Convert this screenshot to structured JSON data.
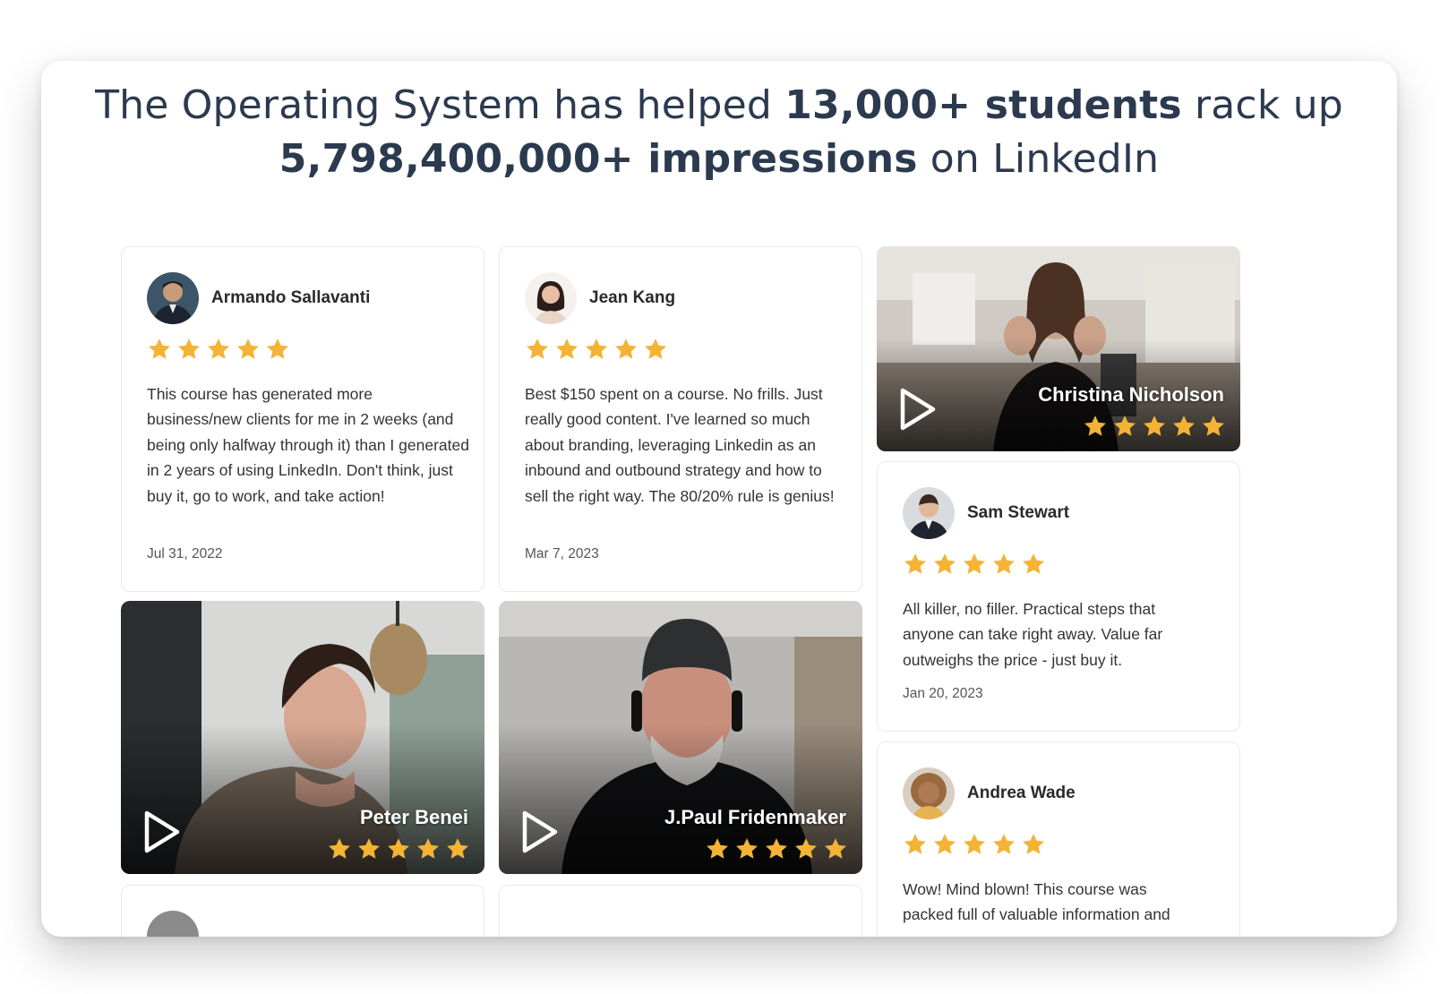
{
  "headline": {
    "line1_a": "The Operating System has helped ",
    "line1_b": "13,000+ students",
    "line1_c": " rack up",
    "line2_a": "5,798,400,000+ impressions",
    "line2_b": " on LinkedIn"
  },
  "reviews": [
    {
      "name": "Armando Sallavanti",
      "rating": 5,
      "text": "This course has generated more business/new clients for me in 2 weeks (and being only halfway through it) than I generated in 2 years of using LinkedIn. Don't think, just buy it, go to work, and take action!",
      "date": "Jul 31, 2022"
    },
    {
      "name": "Jean Kang",
      "rating": 5,
      "text": "Best $150 spent on a course. No frills. Just really good content. I've learned so much about branding, leveraging Linkedin as an inbound and outbound strategy and how to sell the right way. The 80/20% rule is genius!",
      "date": "Mar 7, 2023"
    },
    {
      "name": "Sam Stewart",
      "rating": 5,
      "text": "All killer, no filler. Practical steps that anyone can take right away. Value far outweighs the price - just buy it.",
      "date": "Jan 20, 2023"
    },
    {
      "name": "Andrea Wade",
      "rating": 5,
      "text": "Wow! Mind blown! This course was packed full of valuable information and",
      "date": ""
    }
  ],
  "videos": [
    {
      "name": "Christina Nicholson",
      "rating": 5
    },
    {
      "name": "Peter Benei",
      "rating": 5
    },
    {
      "name": "J.Paul Fridenmaker",
      "rating": 5
    }
  ],
  "colors": {
    "star": "#f5b335",
    "headline": "#2b3a4e",
    "card_border": "#e9e9ec"
  },
  "icons": [
    "star-icon",
    "play-icon"
  ]
}
